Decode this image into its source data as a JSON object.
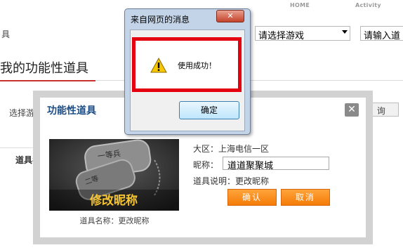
{
  "nav": {
    "home": "HOME",
    "activity": "Activity"
  },
  "toolbar": {
    "left_fragment": "具",
    "game_select_value": "请选择游戏",
    "prompt_input_value": "请输入道"
  },
  "page": {
    "heading": "我的功能性道具",
    "select_label": "选择游",
    "query_button": "查 询",
    "table_col": "道具名"
  },
  "item_dialog": {
    "title": "功能性道具",
    "close_glyph": "✕",
    "image_text": "修改昵称",
    "caption": "道具名称：更改昵称",
    "region": "大区：上海电信一区",
    "nickname_label": "昵称：",
    "nickname_value": "道道聚聚城",
    "description": "道具说明：更改昵称",
    "confirm": "确认",
    "cancel": "取消"
  },
  "alert": {
    "title": "来自网页的消息",
    "close_glyph": "✕",
    "message": "使用成功！",
    "ok": "确定"
  },
  "colors": {
    "accent_red": "#c8322f",
    "title_blue": "#1c4d84",
    "button_orange": "#f47b07",
    "highlight_red": "#e4000f"
  }
}
